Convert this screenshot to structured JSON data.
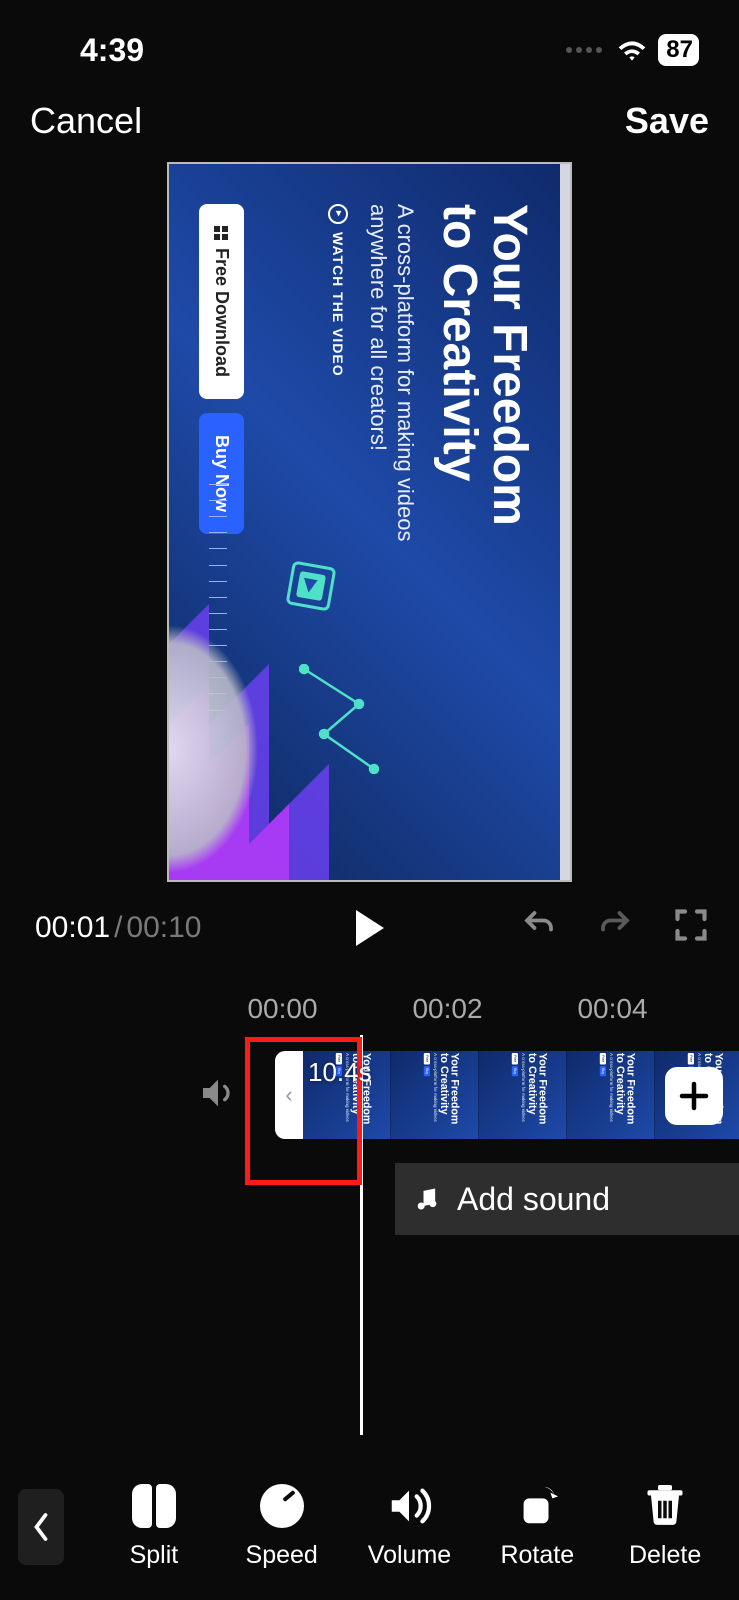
{
  "status": {
    "time": "4:39",
    "battery": "87"
  },
  "header": {
    "cancel": "Cancel",
    "save": "Save"
  },
  "preview": {
    "title_l1": "Your Freedom",
    "title_l2": "to Creativity",
    "subtitle": "A cross-platform for making videos anywhere for all creators!",
    "watch": "WATCH THE VIDEO",
    "download": "Free Download",
    "buy": "Buy Now"
  },
  "playback": {
    "current": "00:01",
    "sep": "/",
    "total": "00:10"
  },
  "ruler": {
    "t0": "00:00",
    "t1": "00:02",
    "t2": "00:04"
  },
  "timeline": {
    "clip_duration": "10.4s",
    "add_sound": "Add sound"
  },
  "tools": {
    "split": "Split",
    "speed": "Speed",
    "volume": "Volume",
    "rotate": "Rotate",
    "delete": "Delete"
  }
}
